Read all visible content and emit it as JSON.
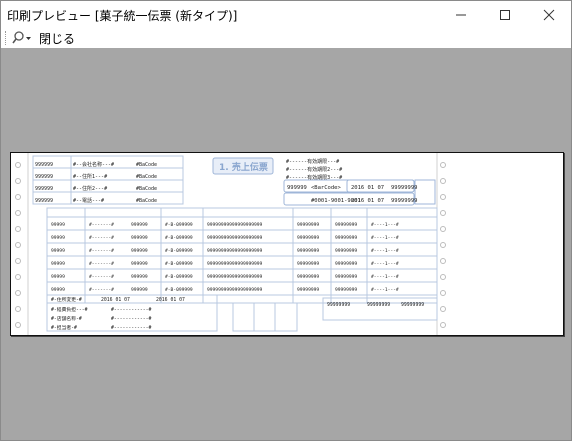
{
  "window": {
    "title": "印刷プレビュー [菓子統一伝票 (新タイプ)]",
    "controls": {
      "minimize": "—",
      "maximize": "☐",
      "close": "✕"
    }
  },
  "toolbar": {
    "zoom_icon": "magnifier-icon",
    "close_label": "閉じる"
  },
  "form": {
    "title": "1. 売上伝票",
    "dates": [
      "2016 01 07",
      "2016 01 07"
    ],
    "code_placeholder": "<BarCode>",
    "jan_code": "#0001-9001-9001",
    "codes_short": [
      "999999",
      "<BaCode>"
    ],
    "totals": [
      "99999999",
      "99999999",
      "99999999"
    ],
    "footer_date_1": "2016 01 07",
    "footer_date_2": "2016 01 07"
  },
  "colors": {
    "preview_bg": "#a6a6a6",
    "form_blue": "#9fb6d8",
    "title_bar_bg": "#ffffff"
  }
}
